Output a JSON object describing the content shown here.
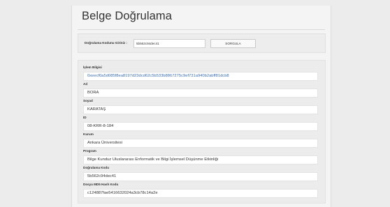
{
  "page": {
    "title": "Belge Doğrulama"
  },
  "verify": {
    "label": "Doğrulama Kodunu Giriniz :",
    "code_value": "5b562c94dec41",
    "button_label": "SORGULA"
  },
  "fields": [
    {
      "label": "İşlem Bilgisi",
      "value": "0xeecf0a5d085f8ea8197d23dcd62c5b533b8867275c9ef731a940b2abff81dcb8",
      "is_link": true
    },
    {
      "label": "Ad",
      "value": "BORA"
    },
    {
      "label": "Soyad",
      "value": "KARATAŞ"
    },
    {
      "label": "ID",
      "value": "08-KRR-8-184"
    },
    {
      "label": "Kurum",
      "value": "Ankara Üniversitesi"
    },
    {
      "label": "Program",
      "value": "Bilge Kunduz Uluslararası Enformatik ve Bilgi İşlemsel Düşünme Etkinliği"
    },
    {
      "label": "Doğrulama Kodu",
      "value": "5b562c94dec41"
    },
    {
      "label": "Dosya MD5 Hash Kodu",
      "value": "c124887fae5416632024a3cb78c14a2e"
    }
  ],
  "colors": {
    "link": "#3b6fb6",
    "background": "#ececec",
    "card": "#f4f4f4"
  }
}
